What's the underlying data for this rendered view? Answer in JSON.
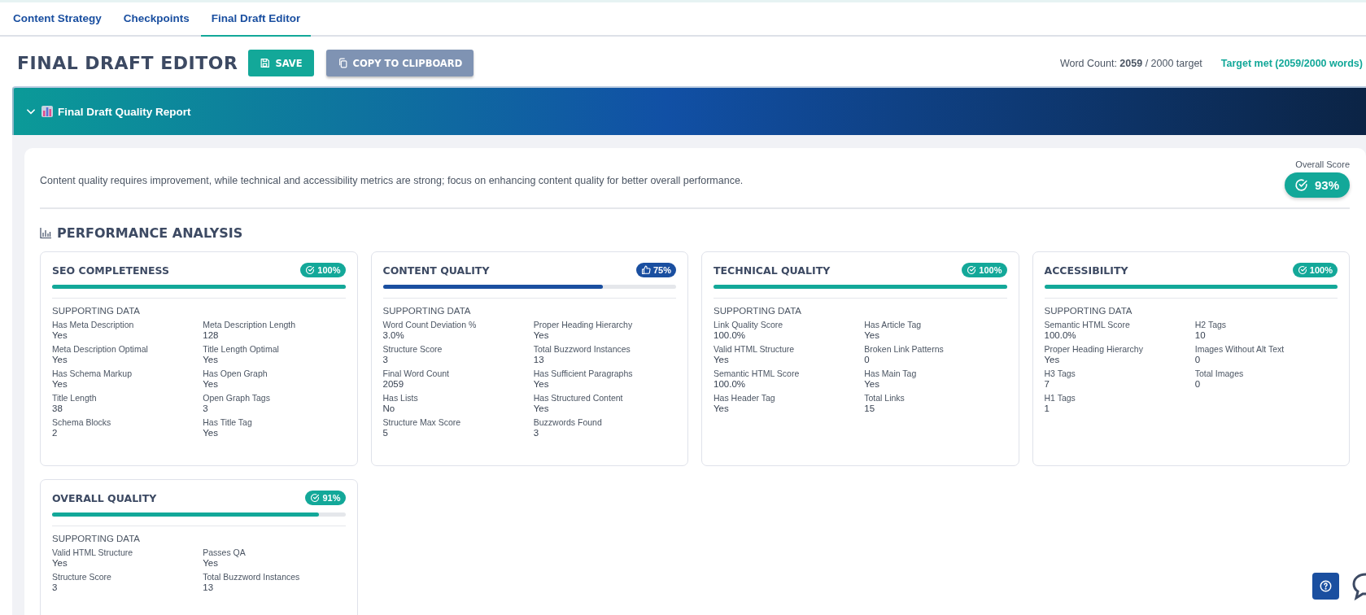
{
  "tabs": [
    {
      "label": "Content Strategy",
      "selected": false
    },
    {
      "label": "Checkpoints",
      "selected": false
    },
    {
      "label": "Final Draft Editor",
      "selected": true
    }
  ],
  "header": {
    "title": "FINAL DRAFT EDITOR",
    "save_button": "SAVE",
    "copy_button": "COPY TO CLIPBOARD",
    "word_count": "Word Count: **2059** / 2000 target",
    "target_status": "Target met (2059/2000 words)"
  },
  "report": {
    "title": "Final Draft Quality Report",
    "expanded": true
  },
  "summary": {
    "text": "Content quality requires improvement, while technical and accessibility metrics are strong; focus on enhancing content quality for better overall performance.",
    "overall_label": "Overall Score",
    "overall_score": "93%"
  },
  "analysis": {
    "heading": "PERFORMANCE ANALYSIS",
    "cards": [
      {
        "title": "SEO COMPLETENESS",
        "supporting_label": "SUPPORTING DATA",
        "badge": "100%",
        "kind": "check",
        "color": "#13a899",
        "level": 1.0,
        "items": [
          {
            "label": "Has Meta Description",
            "value": "Yes"
          },
          {
            "label": "Meta Description Length",
            "value": "128"
          },
          {
            "label": "Meta Description Optimal",
            "value": "Yes"
          },
          {
            "label": "Title Length Optimal",
            "value": "Yes"
          },
          {
            "label": "Has Schema Markup",
            "value": "Yes"
          },
          {
            "label": "Has Open Graph",
            "value": "Yes"
          },
          {
            "label": "Title Length",
            "value": "38"
          },
          {
            "label": "Open Graph Tags",
            "value": "3"
          },
          {
            "label": "Schema Blocks",
            "value": "2"
          },
          {
            "label": "Has Title Tag",
            "value": "Yes"
          }
        ]
      },
      {
        "title": "CONTENT QUALITY",
        "supporting_label": "SUPPORTING DATA",
        "badge": "75%",
        "kind": "thumb",
        "color": "#1a4fa0",
        "level": 0.75,
        "items": [
          {
            "label": "Word Count Deviation %",
            "value": "3.0%"
          },
          {
            "label": "Proper Heading Hierarchy",
            "value": "Yes"
          },
          {
            "label": "Structure Score",
            "value": "3"
          },
          {
            "label": "Total Buzzword Instances",
            "value": "13"
          },
          {
            "label": "Final Word Count",
            "value": "2059"
          },
          {
            "label": "Has Sufficient Paragraphs",
            "value": "Yes"
          },
          {
            "label": "Has Lists",
            "value": "No"
          },
          {
            "label": "Has Structured Content",
            "value": "Yes"
          },
          {
            "label": "Structure Max Score",
            "value": "5"
          },
          {
            "label": "Buzzwords Found",
            "value": "3"
          }
        ]
      },
      {
        "title": "TECHNICAL QUALITY",
        "supporting_label": "SUPPORTING DATA",
        "badge": "100%",
        "kind": "check",
        "color": "#13a899",
        "level": 1.0,
        "items": [
          {
            "label": "Link Quality Score",
            "value": "100.0%"
          },
          {
            "label": "Has Article Tag",
            "value": "Yes"
          },
          {
            "label": "Valid HTML Structure",
            "value": "Yes"
          },
          {
            "label": "Broken Link Patterns",
            "value": "0"
          },
          {
            "label": "Semantic HTML Score",
            "value": "100.0%"
          },
          {
            "label": "Has Main Tag",
            "value": "Yes"
          },
          {
            "label": "Has Header Tag",
            "value": "Yes"
          },
          {
            "label": "Total Links",
            "value": "15"
          }
        ]
      },
      {
        "title": "ACCESSIBILITY",
        "supporting_label": "SUPPORTING DATA",
        "badge": "100%",
        "kind": "check",
        "color": "#13a899",
        "level": 1.0,
        "items": [
          {
            "label": "Semantic HTML Score",
            "value": "100.0%"
          },
          {
            "label": "H2 Tags",
            "value": "10"
          },
          {
            "label": "Proper Heading Hierarchy",
            "value": "Yes"
          },
          {
            "label": "Images Without Alt Text",
            "value": "0"
          },
          {
            "label": "H3 Tags",
            "value": "7"
          },
          {
            "label": "Total Images",
            "value": "0"
          },
          {
            "label": "H1 Tags",
            "value": "1"
          }
        ]
      },
      {
        "title": "OVERALL QUALITY",
        "supporting_label": "SUPPORTING DATA",
        "badge": "91%",
        "kind": "check",
        "color": "#13a899",
        "level": 0.91,
        "items": [
          {
            "label": "Valid HTML Structure",
            "value": "Yes"
          },
          {
            "label": "Passes QA",
            "value": "Yes"
          },
          {
            "label": "Structure Score",
            "value": "3"
          },
          {
            "label": "Total Buzzword Instances",
            "value": "13"
          }
        ]
      }
    ]
  }
}
